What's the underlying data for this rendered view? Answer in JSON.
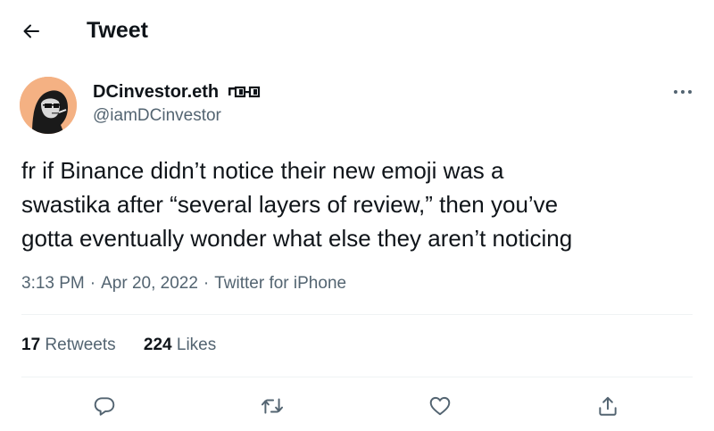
{
  "header": {
    "title": "Tweet",
    "back_icon": "arrow-left-icon"
  },
  "author": {
    "name": "DCinvestor.eth",
    "handle": "@iamDCinvestor",
    "avatar_color": "#f4b183",
    "badge_icon": "pixel-glasses-icon"
  },
  "tweet": {
    "lines": [
      "fr if Binance didn’t notice their new emoji was a",
      "swastika after “several layers of review,” then you’ve",
      "gotta eventually wonder what else they aren’t noticing"
    ],
    "time": "3:13 PM",
    "date": "Apr 20, 2022",
    "source": "Twitter for iPhone",
    "separator": "·"
  },
  "stats": {
    "retweets_count": "17",
    "retweets_label": "Retweets",
    "likes_count": "224",
    "likes_label": "Likes"
  },
  "actions": {
    "reply_icon": "reply-icon",
    "retweet_icon": "retweet-icon",
    "like_icon": "heart-icon",
    "share_icon": "share-icon"
  },
  "colors": {
    "text": "#0f1419",
    "secondary": "#536471",
    "divider": "#eff3f4"
  }
}
